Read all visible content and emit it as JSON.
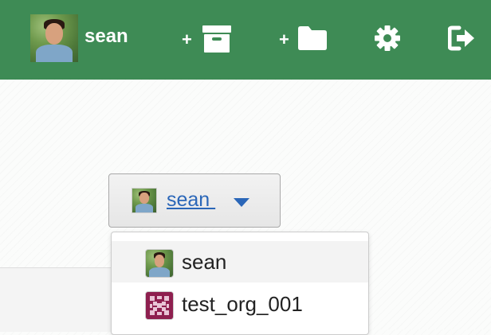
{
  "header": {
    "username": "sean",
    "new_repo_plus": "+",
    "new_org_plus": "+",
    "icons": [
      "user-avatar",
      "archive-box-icon",
      "folder-icon",
      "gear-icon",
      "sign-out-icon"
    ]
  },
  "switcher": {
    "selected_label": "sean ",
    "caret_icon": "caret-down-icon",
    "items": [
      {
        "label": "sean",
        "avatar": "user-avatar",
        "active": true
      },
      {
        "label": "test_org_001",
        "avatar": "org-identicon",
        "active": false
      }
    ]
  },
  "colors": {
    "header_bg": "#3e8b55",
    "link": "#2a66b8",
    "org_avatar": "#8e1f4f"
  }
}
